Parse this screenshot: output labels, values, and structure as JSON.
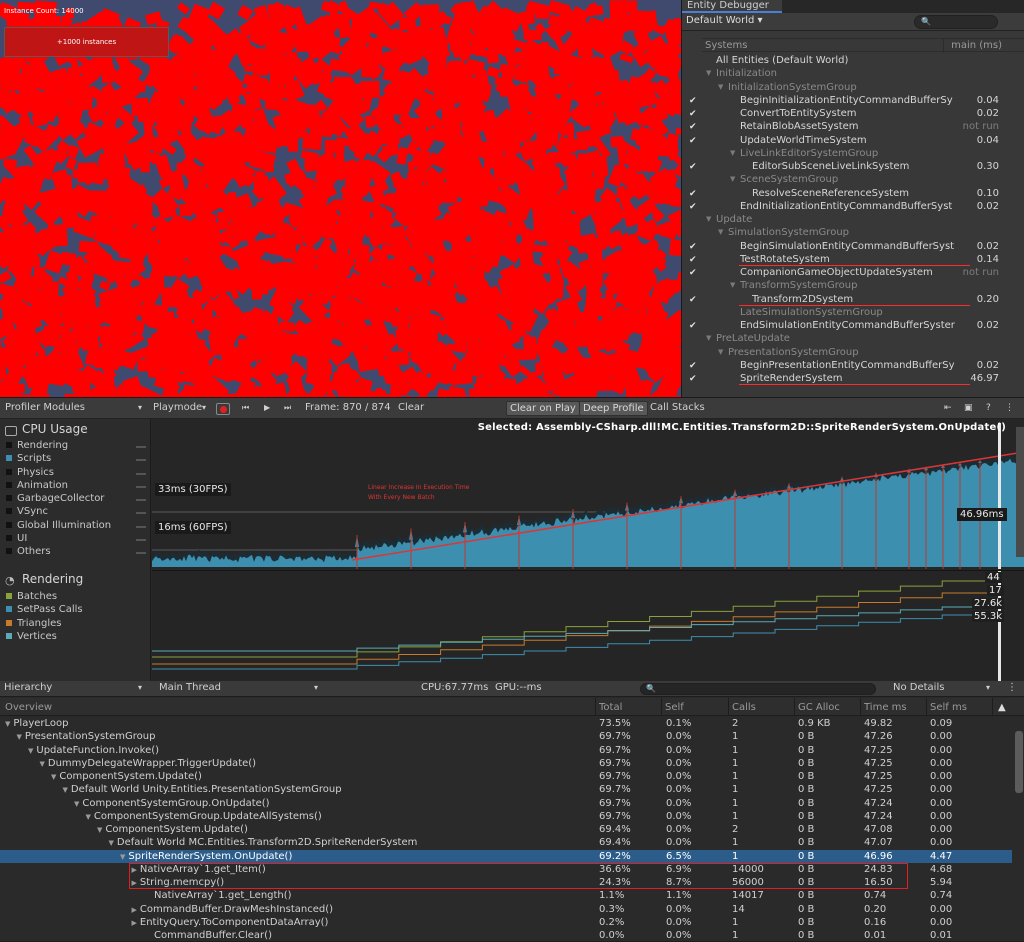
{
  "game": {
    "instance_label": "Instance Count: 14000",
    "button_label": "+1000 instances"
  },
  "entity_debugger": {
    "tab": "Entity Debugger",
    "world": "Default World ▾",
    "search_placeholder": "🔍",
    "col_systems": "Systems",
    "col_time": "main (ms)",
    "rows": [
      {
        "label": "All Entities (Default World)",
        "depth": 0,
        "kind": "all",
        "check": false,
        "time": ""
      },
      {
        "label": "Initialization",
        "depth": 0,
        "kind": "grp",
        "check": false,
        "time": ""
      },
      {
        "label": "InitializationSystemGroup",
        "depth": 1,
        "kind": "grp",
        "check": false,
        "time": ""
      },
      {
        "label": "BeginInitializationEntityCommandBufferSy",
        "depth": 2,
        "kind": "sys",
        "check": true,
        "time": "0.04"
      },
      {
        "label": "ConvertToEntitySystem",
        "depth": 2,
        "kind": "sys",
        "check": true,
        "time": "0.02"
      },
      {
        "label": "RetainBlobAssetSystem",
        "depth": 2,
        "kind": "sys",
        "check": true,
        "time": "not run"
      },
      {
        "label": "UpdateWorldTimeSystem",
        "depth": 2,
        "kind": "sys",
        "check": true,
        "time": "0.04"
      },
      {
        "label": "LiveLinkEditorSystemGroup",
        "depth": 2,
        "kind": "grp",
        "check": false,
        "time": ""
      },
      {
        "label": "EditorSubSceneLiveLinkSystem",
        "depth": 3,
        "kind": "sys",
        "check": true,
        "time": "0.30"
      },
      {
        "label": "SceneSystemGroup",
        "depth": 2,
        "kind": "grp",
        "check": false,
        "time": ""
      },
      {
        "label": "ResolveSceneReferenceSystem",
        "depth": 3,
        "kind": "sys",
        "check": true,
        "time": "0.10"
      },
      {
        "label": "EndInitializationEntityCommandBufferSyst",
        "depth": 2,
        "kind": "sys",
        "check": true,
        "time": "0.02"
      },
      {
        "label": "Update",
        "depth": 0,
        "kind": "grp",
        "check": false,
        "time": ""
      },
      {
        "label": "SimulationSystemGroup",
        "depth": 1,
        "kind": "grp",
        "check": false,
        "time": ""
      },
      {
        "label": "BeginSimulationEntityCommandBufferSyst",
        "depth": 2,
        "kind": "sys",
        "check": true,
        "time": "0.02"
      },
      {
        "label": "TestRotateSystem",
        "depth": 2,
        "kind": "sys",
        "check": true,
        "time": "0.14"
      },
      {
        "label": "CompanionGameObjectUpdateSystem",
        "depth": 2,
        "kind": "sys",
        "check": true,
        "time": "not run"
      },
      {
        "label": "TransformSystemGroup",
        "depth": 2,
        "kind": "grp",
        "check": false,
        "time": ""
      },
      {
        "label": "Transform2DSystem",
        "depth": 3,
        "kind": "sys",
        "check": true,
        "time": "0.20"
      },
      {
        "label": "LateSimulationSystemGroup",
        "depth": 2,
        "kind": "grp-leaf",
        "check": false,
        "time": ""
      },
      {
        "label": "EndSimulationEntityCommandBufferSyster",
        "depth": 2,
        "kind": "sys",
        "check": true,
        "time": "0.02"
      },
      {
        "label": "PreLateUpdate",
        "depth": 0,
        "kind": "grp",
        "check": false,
        "time": ""
      },
      {
        "label": "PresentationSystemGroup",
        "depth": 1,
        "kind": "grp",
        "check": false,
        "time": ""
      },
      {
        "label": "BeginPresentationEntityCommandBufferSy",
        "depth": 2,
        "kind": "sys",
        "check": true,
        "time": "0.02"
      },
      {
        "label": "SpriteRenderSystem",
        "depth": 2,
        "kind": "sys",
        "check": true,
        "time": "46.97"
      }
    ]
  },
  "profiler": {
    "modules_label": "Profiler Modules",
    "playmode": "Playmode",
    "frame": "Frame: 870 / 874",
    "clear": "Clear",
    "clear_on_play": "Clear on Play",
    "deep_profile": "Deep Profile",
    "call_stacks": "Call Stacks",
    "selected": "Selected: Assembly-CSharp.dll!MC.Entities.Transform2D::SpriteRenderSystem.OnUpdate()",
    "cpu_title": "CPU Usage",
    "cpu_legend": [
      {
        "label": "Rendering",
        "color": "#1a1a1a"
      },
      {
        "label": "Scripts",
        "color": "#3d8fb0"
      },
      {
        "label": "Physics",
        "color": "#1a1a1a"
      },
      {
        "label": "Animation",
        "color": "#1a1a1a"
      },
      {
        "label": "GarbageCollector",
        "color": "#1a1a1a"
      },
      {
        "label": "VSync",
        "color": "#1a1a1a"
      },
      {
        "label": "Global Illumination",
        "color": "#1a1a1a"
      },
      {
        "label": "UI",
        "color": "#1a1a1a"
      },
      {
        "label": "Others",
        "color": "#1a1a1a"
      }
    ],
    "line_30fps": "33ms (30FPS)",
    "line_60fps": "16ms (60FPS)",
    "current_ms": "46.96ms",
    "annotation_line1": "Linear Increase In Execution Time",
    "annotation_line2": "With Every New Batch",
    "rendering_title": "Rendering",
    "rendering_legend": [
      {
        "label": "Batches",
        "color": "#8aa23a"
      },
      {
        "label": "SetPass Calls",
        "color": "#3d8fb0"
      },
      {
        "label": "Triangles",
        "color": "#c87a2a"
      },
      {
        "label": "Vertices",
        "color": "#5aaab8"
      }
    ],
    "rendering_values": [
      "44",
      "17",
      "27.6k",
      "55.3k"
    ]
  },
  "hierarchy": {
    "view": "Hierarchy",
    "thread": "Main Thread",
    "cpu": "CPU:67.77ms",
    "gpu": "GPU:--ms",
    "search": "🔍",
    "details": "No Details",
    "columns": [
      "Overview",
      "Total",
      "Self",
      "Calls",
      "GC Alloc",
      "Time ms",
      "Self ms",
      "▲"
    ],
    "rows": [
      {
        "name": "PlayerLoop",
        "depth": 0,
        "arrow": "▼",
        "total": "73.5%",
        "self": "0.1%",
        "calls": "2",
        "gc": "0.9 KB",
        "time": "49.82",
        "selfms": "0.09"
      },
      {
        "name": "PresentationSystemGroup",
        "depth": 1,
        "arrow": "▼",
        "total": "69.7%",
        "self": "0.0%",
        "calls": "1",
        "gc": "0 B",
        "time": "47.26",
        "selfms": "0.00"
      },
      {
        "name": "UpdateFunction.Invoke()",
        "depth": 2,
        "arrow": "▼",
        "total": "69.7%",
        "self": "0.0%",
        "calls": "1",
        "gc": "0 B",
        "time": "47.25",
        "selfms": "0.00"
      },
      {
        "name": "DummyDelegateWrapper.TriggerUpdate()",
        "depth": 3,
        "arrow": "▼",
        "total": "69.7%",
        "self": "0.0%",
        "calls": "1",
        "gc": "0 B",
        "time": "47.25",
        "selfms": "0.00"
      },
      {
        "name": "ComponentSystem.Update()",
        "depth": 4,
        "arrow": "▼",
        "total": "69.7%",
        "self": "0.0%",
        "calls": "1",
        "gc": "0 B",
        "time": "47.25",
        "selfms": "0.00"
      },
      {
        "name": "Default World Unity.Entities.PresentationSystemGroup",
        "depth": 5,
        "arrow": "▼",
        "total": "69.7%",
        "self": "0.0%",
        "calls": "1",
        "gc": "0 B",
        "time": "47.25",
        "selfms": "0.00"
      },
      {
        "name": "ComponentSystemGroup.OnUpdate()",
        "depth": 6,
        "arrow": "▼",
        "total": "69.7%",
        "self": "0.0%",
        "calls": "1",
        "gc": "0 B",
        "time": "47.24",
        "selfms": "0.00"
      },
      {
        "name": "ComponentSystemGroup.UpdateAllSystems()",
        "depth": 7,
        "arrow": "▼",
        "total": "69.7%",
        "self": "0.0%",
        "calls": "1",
        "gc": "0 B",
        "time": "47.24",
        "selfms": "0.00"
      },
      {
        "name": "ComponentSystem.Update()",
        "depth": 8,
        "arrow": "▼",
        "total": "69.4%",
        "self": "0.0%",
        "calls": "2",
        "gc": "0 B",
        "time": "47.08",
        "selfms": "0.00"
      },
      {
        "name": "Default World MC.Entities.Transform2D.SpriteRenderSystem",
        "depth": 9,
        "arrow": "▼",
        "total": "69.4%",
        "self": "0.0%",
        "calls": "1",
        "gc": "0 B",
        "time": "47.07",
        "selfms": "0.00"
      },
      {
        "name": "SpriteRenderSystem.OnUpdate()",
        "depth": 10,
        "arrow": "▼",
        "total": "69.2%",
        "self": "6.5%",
        "calls": "1",
        "gc": "0 B",
        "time": "46.96",
        "selfms": "4.47",
        "selected": true
      },
      {
        "name": "NativeArray`1.get_Item()",
        "depth": 11,
        "arrow": "▶",
        "total": "36.6%",
        "self": "6.9%",
        "calls": "14000",
        "gc": "0 B",
        "time": "24.83",
        "selfms": "4.68"
      },
      {
        "name": "String.memcpy()",
        "depth": 11,
        "arrow": "▶",
        "total": "24.3%",
        "self": "8.7%",
        "calls": "56000",
        "gc": "0 B",
        "time": "16.50",
        "selfms": "5.94"
      },
      {
        "name": "NativeArray`1.get_Length()",
        "depth": 12,
        "arrow": "",
        "total": "1.1%",
        "self": "1.1%",
        "calls": "14017",
        "gc": "0 B",
        "time": "0.74",
        "selfms": "0.74"
      },
      {
        "name": "CommandBuffer.DrawMeshInstanced()",
        "depth": 11,
        "arrow": "▶",
        "total": "0.3%",
        "self": "0.0%",
        "calls": "14",
        "gc": "0 B",
        "time": "0.20",
        "selfms": "0.00"
      },
      {
        "name": "EntityQuery.ToComponentDataArray()",
        "depth": 11,
        "arrow": "▶",
        "total": "0.2%",
        "self": "0.0%",
        "calls": "1",
        "gc": "0 B",
        "time": "0.16",
        "selfms": "0.00"
      },
      {
        "name": "CommandBuffer.Clear()",
        "depth": 12,
        "arrow": "",
        "total": "0.0%",
        "self": "0.0%",
        "calls": "1",
        "gc": "0 B",
        "time": "0.01",
        "selfms": "0.01"
      }
    ]
  },
  "colors": {
    "sprite_red": "#ff0000",
    "background_blue": "#3f4a6e",
    "annotation_red": "#e03434",
    "cpu_scripts": "#3d8fb0",
    "selection": "#2c5d8a"
  }
}
